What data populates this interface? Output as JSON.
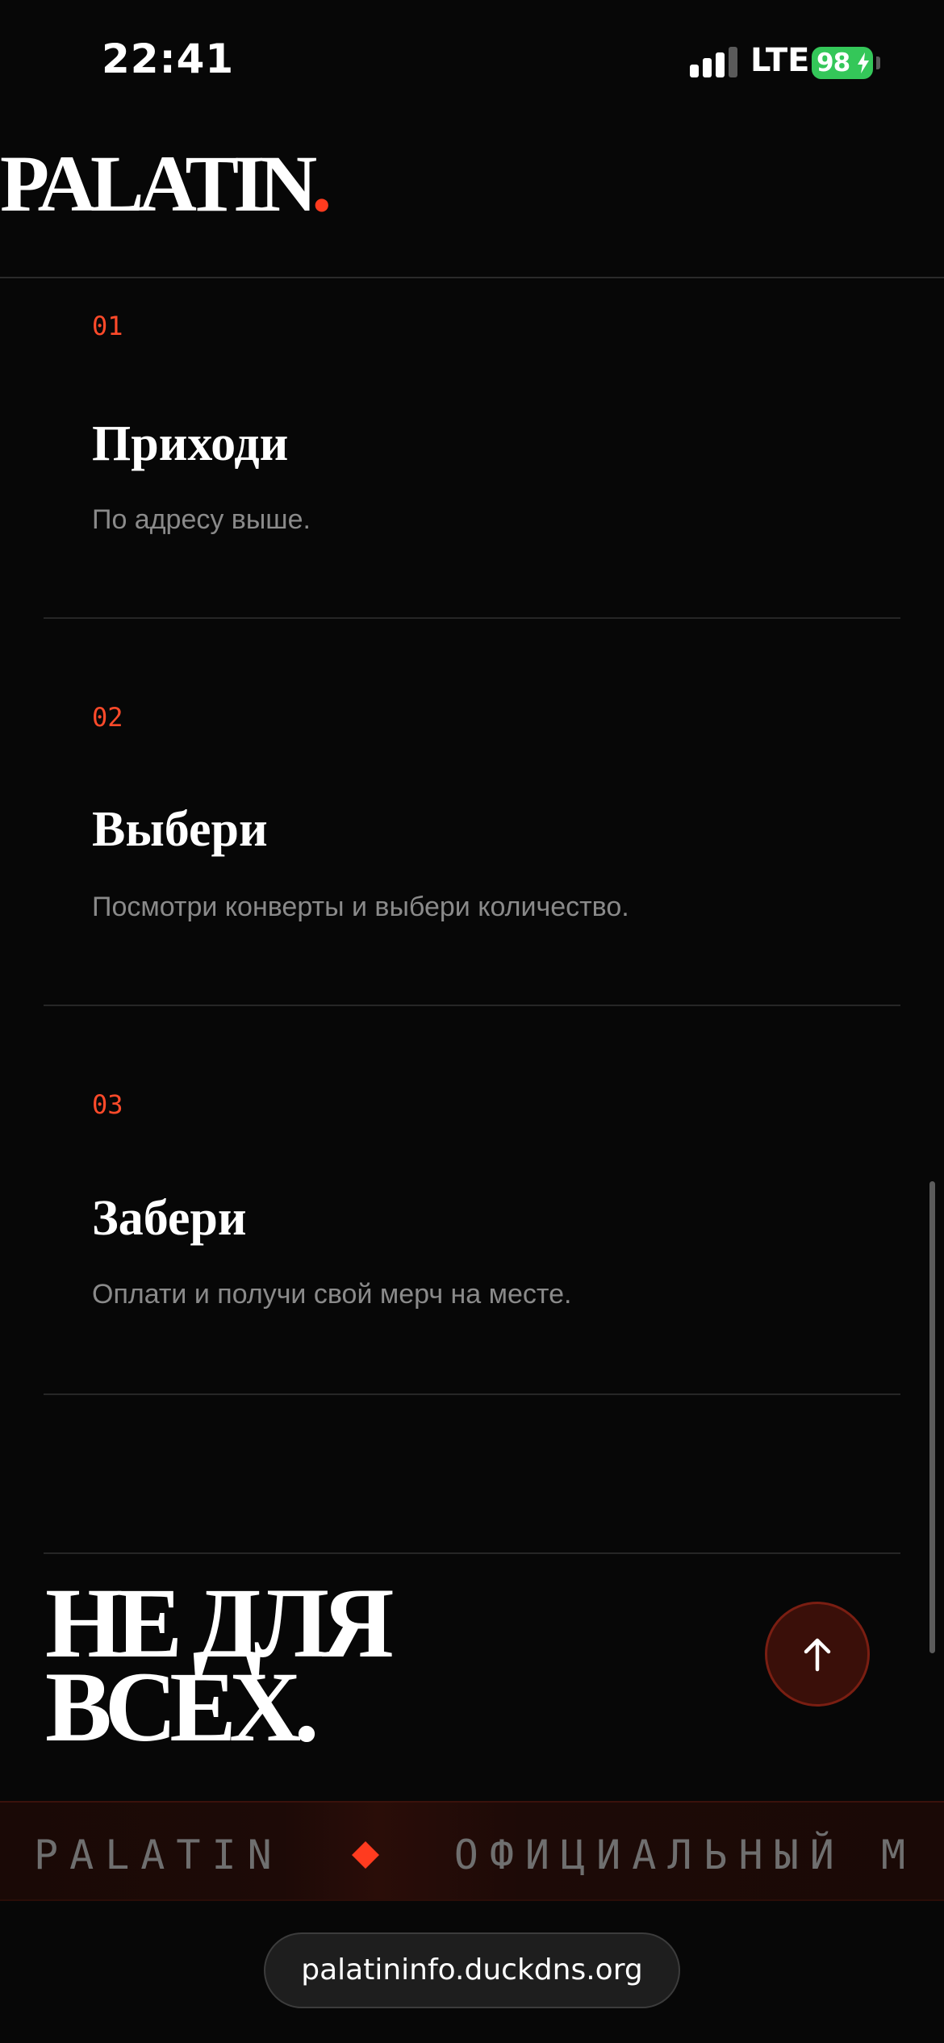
{
  "status_bar": {
    "time": "22:41",
    "network": "LTE",
    "battery": "98"
  },
  "header": {
    "logo": "PALATIN",
    "logo_dot": "."
  },
  "steps": [
    {
      "number": "01",
      "title": "Приходи",
      "description": "По адресу выше."
    },
    {
      "number": "02",
      "title": "Выбери",
      "description": "Посмотри конверты и выбери количество."
    },
    {
      "number": "03",
      "title": "Забери",
      "description": "Оплати и получи свой мерч на месте."
    }
  ],
  "slogan": {
    "line1": "НЕ ДЛЯ",
    "line2": "ВСЕХ."
  },
  "marquee": {
    "item1": "PALATIN",
    "item2": "ОФИЦИАЛЬНЫЙ М"
  },
  "browser": {
    "url": "palatininfo.duckdns.org"
  },
  "colors": {
    "accent": "#ff3b1f",
    "background": "#070707",
    "muted_text": "#8a8a8a"
  }
}
